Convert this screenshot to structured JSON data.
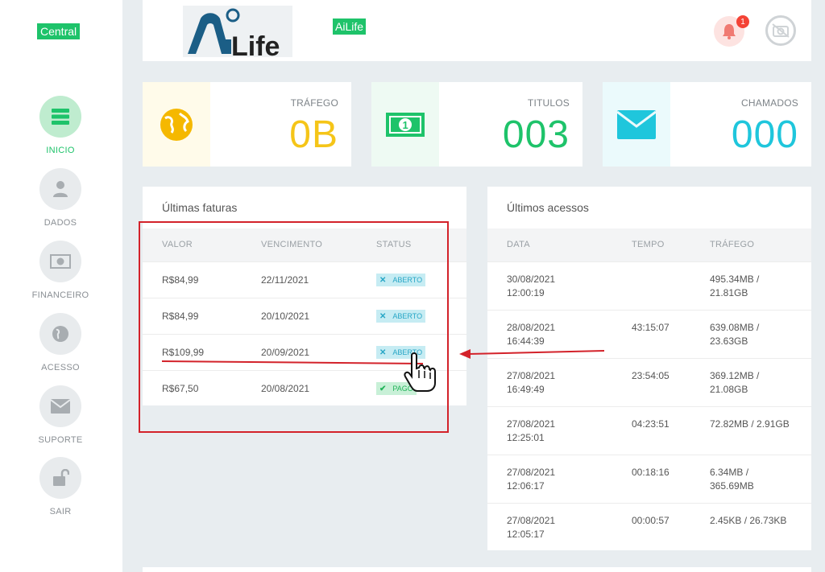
{
  "sidebar": {
    "brand": "Central",
    "items": [
      {
        "label": "INICIO",
        "icon": "server-icon",
        "active": true
      },
      {
        "label": "DADOS",
        "icon": "user-icon",
        "active": false
      },
      {
        "label": "FINANCEIRO",
        "icon": "money-icon",
        "active": false
      },
      {
        "label": "ACESSO",
        "icon": "globe-icon",
        "active": false
      },
      {
        "label": "SUPORTE",
        "icon": "envelope-icon",
        "active": false
      },
      {
        "label": "SAIR",
        "icon": "unlock-icon",
        "active": false
      }
    ]
  },
  "header": {
    "logo_text": "AiLife",
    "app_badge": "AiLife",
    "notification_count": "1"
  },
  "stats": [
    {
      "label": "TRÁFEGO",
      "value": "0B",
      "color": "#f5c518",
      "icon": "globe-icon"
    },
    {
      "label": "TITULOS",
      "value": "003",
      "color": "#1ec36a",
      "icon": "money-icon"
    },
    {
      "label": "CHAMADOS",
      "value": "000",
      "color": "#1fc6dc",
      "icon": "envelope-icon"
    }
  ],
  "faturas": {
    "title": "Últimas faturas",
    "columns": [
      "VALOR",
      "VENCIMENTO",
      "STATUS"
    ],
    "rows": [
      {
        "valor": "R$84,99",
        "vencimento": "22/11/2021",
        "status": "ABERTO"
      },
      {
        "valor": "R$84,99",
        "vencimento": "20/10/2021",
        "status": "ABERTO"
      },
      {
        "valor": "R$109,99",
        "vencimento": "20/09/2021",
        "status": "ABERTO"
      },
      {
        "valor": "R$67,50",
        "vencimento": "20/08/2021",
        "status": "PAGO"
      }
    ]
  },
  "acessos": {
    "title": "Últimos acessos",
    "columns": [
      "DATA",
      "TEMPO",
      "TRÁFEGO"
    ],
    "rows": [
      {
        "data1": "30/08/2021",
        "data2": "12:00:19",
        "tempo": "",
        "trafego1": "495.34MB /",
        "trafego2": "21.81GB"
      },
      {
        "data1": "28/08/2021",
        "data2": "16:44:39",
        "tempo": "43:15:07",
        "trafego1": "639.08MB /",
        "trafego2": "23.63GB"
      },
      {
        "data1": "27/08/2021",
        "data2": "16:49:49",
        "tempo": "23:54:05",
        "trafego1": "369.12MB /",
        "trafego2": "21.08GB"
      },
      {
        "data1": "27/08/2021",
        "data2": "12:25:01",
        "tempo": "04:23:51",
        "trafego1": "72.82MB / 2.91GB",
        "trafego2": ""
      },
      {
        "data1": "27/08/2021",
        "data2": "12:06:17",
        "tempo": "00:18:16",
        "trafego1": "6.34MB /",
        "trafego2": "365.69MB"
      },
      {
        "data1": "27/08/2021",
        "data2": "12:05:17",
        "tempo": "00:00:57",
        "trafego1": "2.45KB / 26.73KB",
        "trafego2": ""
      }
    ]
  },
  "colors": {
    "accent": "#1ec36a",
    "aberto": "#27a6c6",
    "pago": "#23b45a",
    "annotation": "#d3222a"
  }
}
